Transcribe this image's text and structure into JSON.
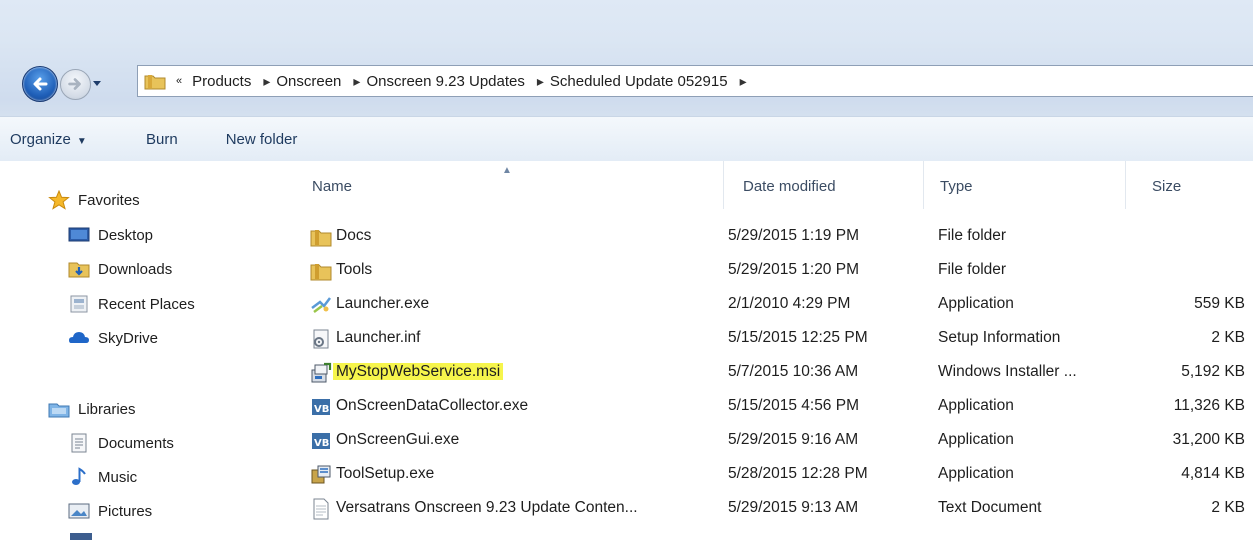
{
  "address_bar": {
    "overflow_chevron": "«",
    "crumbs": [
      "Products",
      "Onscreen",
      "Onscreen 9.23 Updates",
      "Scheduled Update 052915"
    ],
    "separator": "▸"
  },
  "toolbar": {
    "organize_label": "Organize",
    "burn_label": "Burn",
    "new_folder_label": "New folder"
  },
  "nav": {
    "favorites_label": "Favorites",
    "favorites": [
      "Desktop",
      "Downloads",
      "Recent Places",
      "SkyDrive"
    ],
    "libraries_label": "Libraries",
    "libraries": [
      "Documents",
      "Music",
      "Pictures"
    ]
  },
  "columns": {
    "name": "Name",
    "date": "Date modified",
    "type": "Type",
    "size": "Size"
  },
  "files": [
    {
      "name": "Docs",
      "date": "5/29/2015 1:19 PM",
      "type": "File folder",
      "size": "",
      "icon": "folder-icon"
    },
    {
      "name": "Tools",
      "date": "5/29/2015 1:20 PM",
      "type": "File folder",
      "size": "",
      "icon": "folder-icon"
    },
    {
      "name": "Launcher.exe",
      "date": "2/1/2010 4:29 PM",
      "type": "Application",
      "size": "559 KB",
      "icon": "launcher-exe-icon"
    },
    {
      "name": "Launcher.inf",
      "date": "5/15/2015 12:25 PM",
      "type": "Setup Information",
      "size": "2 KB",
      "icon": "setup-info-icon"
    },
    {
      "name": "MyStopWebService.msi",
      "date": "5/7/2015 10:36 AM",
      "type": "Windows Installer ...",
      "size": "5,192 KB",
      "icon": "msi-installer-icon",
      "highlighted": true
    },
    {
      "name": "OnScreenDataCollector.exe",
      "date": "5/15/2015 4:56 PM",
      "type": "Application",
      "size": "11,326 KB",
      "icon": "vb-app-icon"
    },
    {
      "name": "OnScreenGui.exe",
      "date": "5/29/2015 9:16 AM",
      "type": "Application",
      "size": "31,200 KB",
      "icon": "vb-app-icon"
    },
    {
      "name": "ToolSetup.exe",
      "date": "5/28/2015 12:28 PM",
      "type": "Application",
      "size": "4,814 KB",
      "icon": "setup-exe-icon"
    },
    {
      "name": "Versatrans Onscreen 9.23 Update Conten...",
      "date": "5/29/2015 9:13 AM",
      "type": "Text Document",
      "size": "2 KB",
      "icon": "text-document-icon"
    }
  ],
  "colors": {
    "highlight": "#f6f54c",
    "folder": "#e8c35a",
    "back_button": "#1f5fb8"
  }
}
